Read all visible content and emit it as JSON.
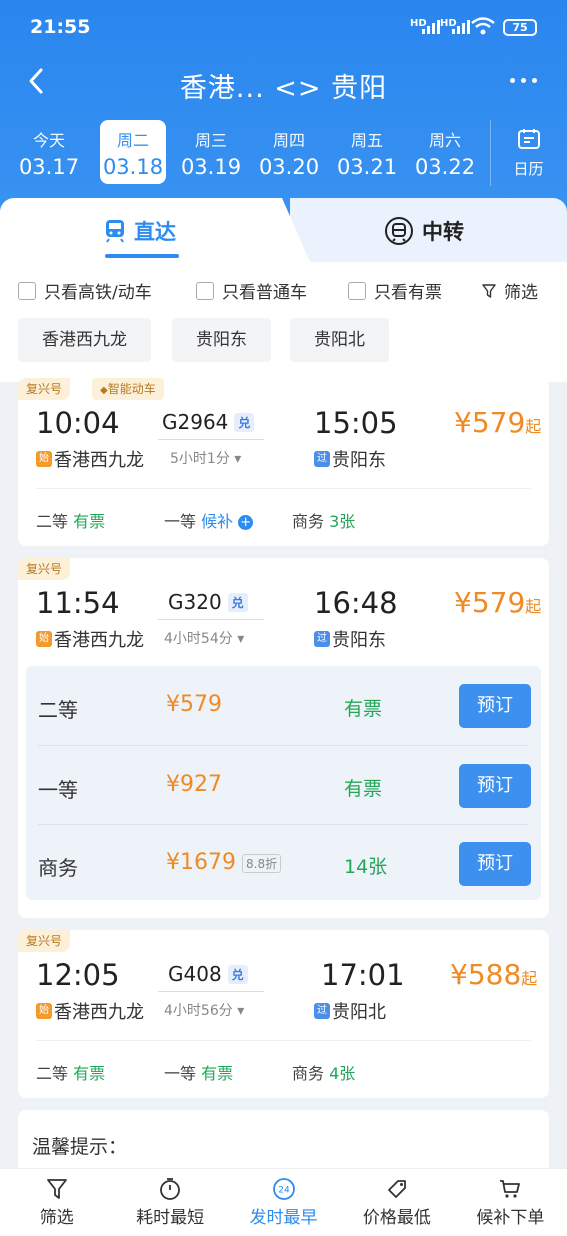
{
  "status": {
    "time": "21:55",
    "sig1": "HD",
    "sig2": "HD",
    "battery": "75"
  },
  "nav": {
    "title": "香港... <> 贵阳"
  },
  "dates": [
    {
      "week": "今天",
      "date": "03.17",
      "selected": false
    },
    {
      "week": "周二",
      "date": "03.18",
      "selected": true
    },
    {
      "week": "周三",
      "date": "03.19",
      "selected": false
    },
    {
      "week": "周四",
      "date": "03.20",
      "selected": false
    },
    {
      "week": "周五",
      "date": "03.21",
      "selected": false
    },
    {
      "week": "周六",
      "date": "03.22",
      "selected": false
    }
  ],
  "calendar_label": "日历",
  "tabs": {
    "direct": "直达",
    "transfer": "中转"
  },
  "filters": {
    "high_speed": "只看高铁/动车",
    "normal": "只看普通车",
    "available": "只看有票",
    "filter": "筛选",
    "stations": [
      "香港西九龙",
      "贵阳东",
      "贵阳北"
    ]
  },
  "trains": [
    {
      "tags": [
        "复兴号",
        "智能动车"
      ],
      "dep_time": "10:04",
      "train_no": "G2964",
      "dui": "兑",
      "arr_time": "15:05",
      "dep_station": "香港西九龙",
      "dep_badge": "始",
      "duration": "5小时1分",
      "arr_station": "贵阳东",
      "arr_badge": "过",
      "price": "¥579",
      "price_suffix": "起",
      "seats": [
        {
          "name": "二等",
          "status": "有票"
        },
        {
          "name": "一等",
          "status": "候补"
        },
        {
          "name": "商务",
          "status": "3张"
        }
      ]
    },
    {
      "tags": [
        "复兴号"
      ],
      "dep_time": "11:54",
      "train_no": "G320",
      "dui": "兑",
      "arr_time": "16:48",
      "dep_station": "香港西九龙",
      "dep_badge": "始",
      "duration": "4小时54分",
      "arr_station": "贵阳东",
      "arr_badge": "过",
      "price": "¥579",
      "price_suffix": "起",
      "seat_detail": [
        {
          "name": "二等",
          "price": "¥579",
          "discount": "",
          "status": "有票",
          "button": "预订"
        },
        {
          "name": "一等",
          "price": "¥927",
          "discount": "",
          "status": "有票",
          "button": "预订"
        },
        {
          "name": "商务",
          "price": "¥1679",
          "discount": "8.8折",
          "status": "14张",
          "button": "预订"
        }
      ]
    },
    {
      "tags": [
        "复兴号"
      ],
      "dep_time": "12:05",
      "train_no": "G408",
      "dui": "兑",
      "arr_time": "17:01",
      "dep_station": "香港西九龙",
      "dep_badge": "始",
      "duration": "4小时56分",
      "arr_station": "贵阳北",
      "arr_badge": "过",
      "price": "¥588",
      "price_suffix": "起",
      "seats": [
        {
          "name": "二等",
          "status": "有票"
        },
        {
          "name": "一等",
          "status": "有票"
        },
        {
          "name": "商务",
          "status": "4张"
        }
      ]
    }
  ],
  "tip": {
    "title": "温馨提示："
  },
  "bottom": [
    {
      "label": "筛选",
      "icon": "funnel-icon"
    },
    {
      "label": "耗时最短",
      "icon": "timer-icon"
    },
    {
      "label": "发时最早",
      "icon": "clock-24-icon",
      "badge": "24"
    },
    {
      "label": "价格最低",
      "icon": "price-tag-icon"
    },
    {
      "label": "候补下单",
      "icon": "cart-icon"
    }
  ]
}
